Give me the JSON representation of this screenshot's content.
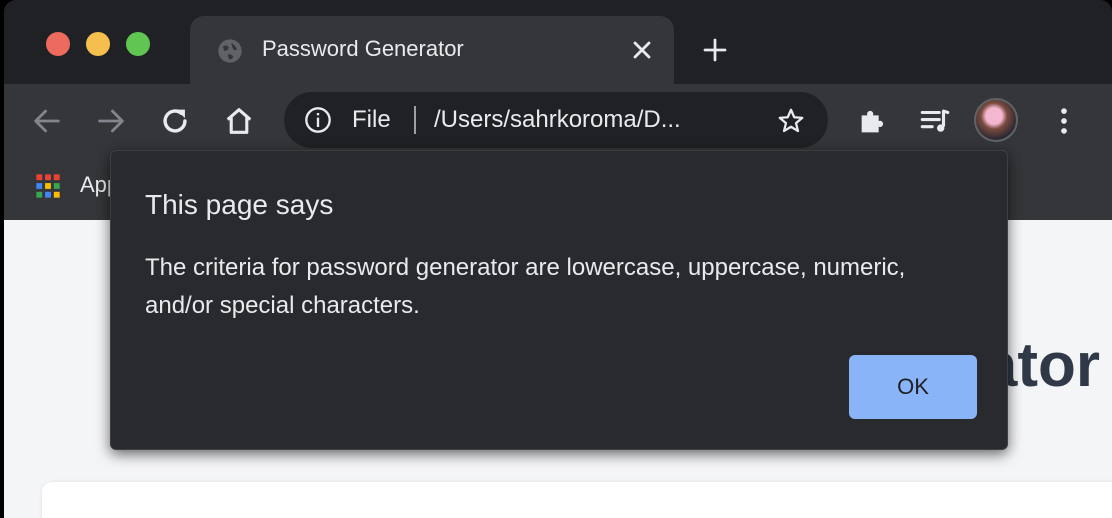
{
  "browser": {
    "tab": {
      "title": "Password Generator",
      "favicon": "globe-icon"
    },
    "omnibox": {
      "scheme_label": "File",
      "url": "/Users/sahrkoroma/D..."
    },
    "bookmarks": {
      "apps_label": "Apps"
    },
    "icons": {
      "back": "arrow-left-icon",
      "forward": "arrow-right-icon",
      "reload": "reload-icon",
      "home": "home-icon",
      "info": "info-icon",
      "star": "star-icon",
      "extensions": "puzzle-icon",
      "media": "media-queue-icon",
      "menu": "three-dots-icon"
    },
    "colors": {
      "frame": "#202124",
      "toolbar": "#35363a",
      "dialog": "#292a2d",
      "accent": "#8ab4f8"
    }
  },
  "page": {
    "heading_fragment": "ator"
  },
  "dialog": {
    "title": "This page says",
    "message": "The criteria for password generator are lowercase, uppercase, numeric, and/or special characters.",
    "ok_label": "OK"
  }
}
